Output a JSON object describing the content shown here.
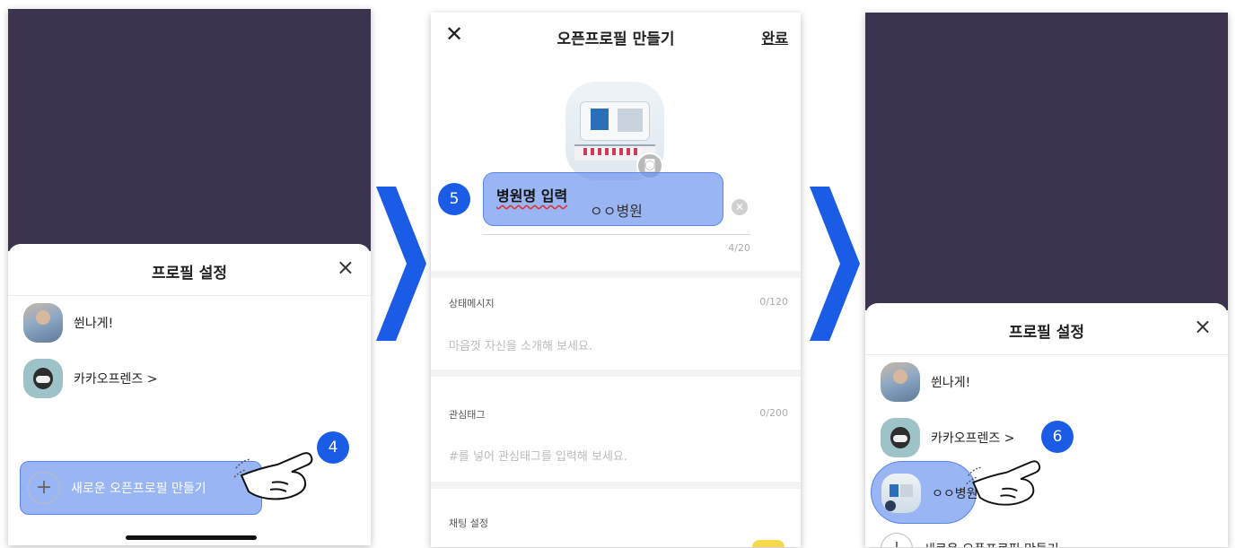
{
  "panel1": {
    "sheet_title": "프로필 설정",
    "close_icon": "×",
    "profiles": [
      {
        "name": "쒼나게!"
      },
      {
        "name": "카카오프렌즈 >"
      }
    ],
    "new_profile_plus": "+",
    "new_profile_label": "새로운 오픈프로필 만들기",
    "step_badge": "4"
  },
  "panel2": {
    "close_icon": "✕",
    "title": "오픈프로필 만들기",
    "done_label": "완료",
    "camera_icon": "◙",
    "step_badge": "5",
    "input_annotation": "병원명 입력",
    "input_value": "ㅇㅇ병원",
    "input_clear": "✕",
    "input_count": "4/20",
    "status_label": "상태메시지",
    "status_count": "0/120",
    "status_placeholder": "마음껏 자신을 소개해 보세요.",
    "tag_label": "관심태그",
    "tag_count": "0/200",
    "tag_placeholder": "#를 넣어 관심태그를 입력해 보세요.",
    "chat_label": "채팅 설정"
  },
  "panel3": {
    "sheet_title": "프로필 설정",
    "close_icon": "×",
    "profiles": [
      {
        "name": "쒼나게!"
      },
      {
        "name": "카카오프렌즈 >"
      },
      {
        "name": "ㅇㅇ병원"
      }
    ],
    "step_badge": "6",
    "new_profile_plus": "+",
    "new_profile_label": "새로운 오픈프로필 만들기"
  },
  "colors": {
    "dark_background": "#3c344f",
    "highlight": "#6e96f0",
    "badge": "#1a5ce6",
    "arrow": "#1a5ce6"
  },
  "icons": [
    "close-icon",
    "plus-icon",
    "camera-icon",
    "clear-icon",
    "pointing-hand-icon",
    "next-step-arrow-icon"
  ]
}
